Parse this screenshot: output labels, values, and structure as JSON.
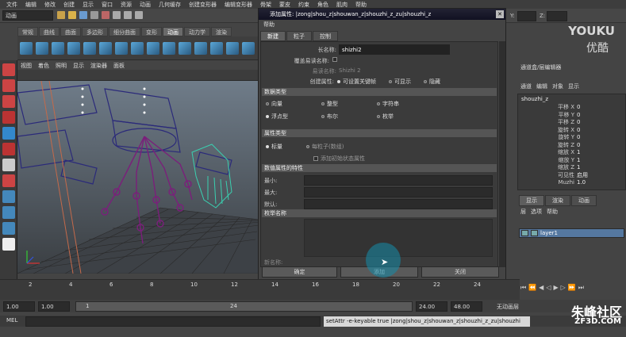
{
  "menubar": [
    "文件",
    "编辑",
    "修改",
    "创建",
    "显示",
    "窗口",
    "资源",
    "动画",
    "几何缓存",
    "创建变形器",
    "编辑变形器",
    "骨架",
    "蒙皮",
    "约束",
    "角色",
    "肌肉",
    "帮助"
  ],
  "mode_selector": "动画",
  "shelf_tabs": [
    "常规",
    "曲线",
    "曲面",
    "多边形",
    "细分曲面",
    "变形",
    "动画",
    "动力学",
    "渲染"
  ],
  "shelf_active": "动画",
  "viewport_menu": [
    "视图",
    "着色",
    "照明",
    "显示",
    "渲染器",
    "面板"
  ],
  "coord_labels": {
    "y": "Y:",
    "z": "Z:"
  },
  "dialog": {
    "title": "添加属性: |zong|shou_z|shouwan_z|shouzhi_z_zu|shouzhi_z",
    "menu": "帮助",
    "tabs": [
      "新建",
      "粒子",
      "控制"
    ],
    "active_tab": "新建",
    "long_name_label": "长名称:",
    "long_name_value": "shizhi2",
    "override_label": "覆盖易读名称:",
    "nice_name_label": "易读名称:",
    "nice_name_value": "Shizhi 2",
    "make_attr_label": "创建属性:",
    "make_attr_options": [
      "可设置关键帧",
      "可显示",
      "隐藏"
    ],
    "data_type_header": "数据类型",
    "data_types": [
      "向量",
      "整型",
      "字符串",
      "浮点型",
      "布尔",
      "枚举"
    ],
    "attr_type_header": "属性类型",
    "attr_types": [
      "标量",
      "每粒子(数组)"
    ],
    "initial_state": "添加初始状态属性",
    "numeric_header": "数值属性的特性",
    "minimum": "最小:",
    "maximum": "最大:",
    "default": "默认:",
    "enum_header": "枚举名称",
    "new_name": "新名称:",
    "buttons": [
      "确定",
      "添加",
      "关闭"
    ]
  },
  "right_panel": {
    "header": "通道盒/层编辑器",
    "menu": [
      "通道",
      "编辑",
      "对象",
      "显示"
    ],
    "object": "shouzhi_z",
    "channels": [
      {
        "name": "平移 X",
        "value": "0"
      },
      {
        "name": "平移 Y",
        "value": "0"
      },
      {
        "name": "平移 Z",
        "value": "0"
      },
      {
        "name": "旋转 X",
        "value": "0"
      },
      {
        "name": "旋转 Y",
        "value": "0"
      },
      {
        "name": "旋转 Z",
        "value": "0"
      },
      {
        "name": "缩放 X",
        "value": "1"
      },
      {
        "name": "缩放 Y",
        "value": "1"
      },
      {
        "name": "缩放 Z",
        "value": "1"
      },
      {
        "name": "可见性",
        "value": "启用"
      },
      {
        "name": "Muzhi",
        "value": "1.0"
      }
    ],
    "layer_tabs": [
      "显示",
      "渲染",
      "动画"
    ],
    "layer_menu": [
      "层",
      "选项",
      "帮助"
    ],
    "layer_name": "layer1"
  },
  "timeline_ticks": [
    "2",
    "4",
    "6",
    "8",
    "10",
    "12",
    "14",
    "16",
    "18",
    "20",
    "22",
    "24"
  ],
  "range": {
    "start": "1.00",
    "start2": "1.00",
    "current": "1",
    "end_marker": "24",
    "end": "24.00",
    "end2": "48.00",
    "anim_layer": "无动画层"
  },
  "cmd": {
    "label": "MEL",
    "output": "setAttr -e-keyable true |zong|shou_z|shouwan_z|shouzhi_z_zu|shouzhi"
  },
  "logos": {
    "youku": "YOUKU",
    "youku_cn": "优酷",
    "zf": "朱峰社区",
    "zf3d": "ZF3D.COM"
  }
}
